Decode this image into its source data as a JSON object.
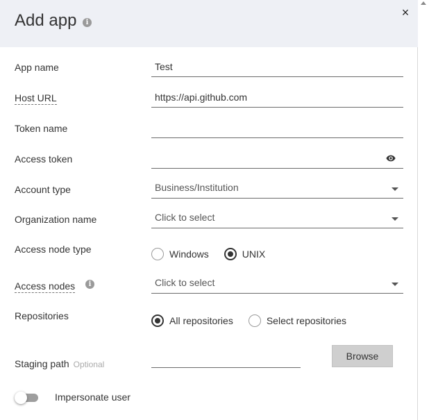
{
  "header": {
    "title": "Add app",
    "info_icon_glyph": "i"
  },
  "close_glyph": "×",
  "fields": {
    "app_name": {
      "label": "App name",
      "value": "Test"
    },
    "host_url": {
      "label": "Host URL",
      "value": "https://api.github.com"
    },
    "token_name": {
      "label": "Token name",
      "value": ""
    },
    "access_token": {
      "label": "Access token",
      "value": ""
    },
    "account_type": {
      "label": "Account type",
      "value": "Business/Institution"
    },
    "organization_name": {
      "label": "Organization name",
      "value": "Click to select"
    },
    "access_node_type": {
      "label": "Access node type",
      "options": [
        {
          "label": "Windows",
          "selected": false
        },
        {
          "label": "UNIX",
          "selected": true
        }
      ]
    },
    "access_nodes": {
      "label": "Access nodes",
      "value": "Click to select",
      "info_icon_glyph": "i"
    },
    "repositories": {
      "label": "Repositories",
      "options": [
        {
          "label": "All repositories",
          "selected": true
        },
        {
          "label": "Select repositories",
          "selected": false
        }
      ]
    },
    "staging_path": {
      "label": "Staging path",
      "optional_text": "Optional",
      "value": "",
      "browse_label": "Browse"
    },
    "impersonate_user": {
      "label": "Impersonate user",
      "enabled": false
    }
  },
  "colors": {
    "header_bg": "#eef0f5",
    "accent": "#333333",
    "button_bg": "#cfcfcf"
  },
  "icons": [
    "info-icon",
    "close-icon",
    "eye-icon",
    "chevron-down-icon"
  ]
}
